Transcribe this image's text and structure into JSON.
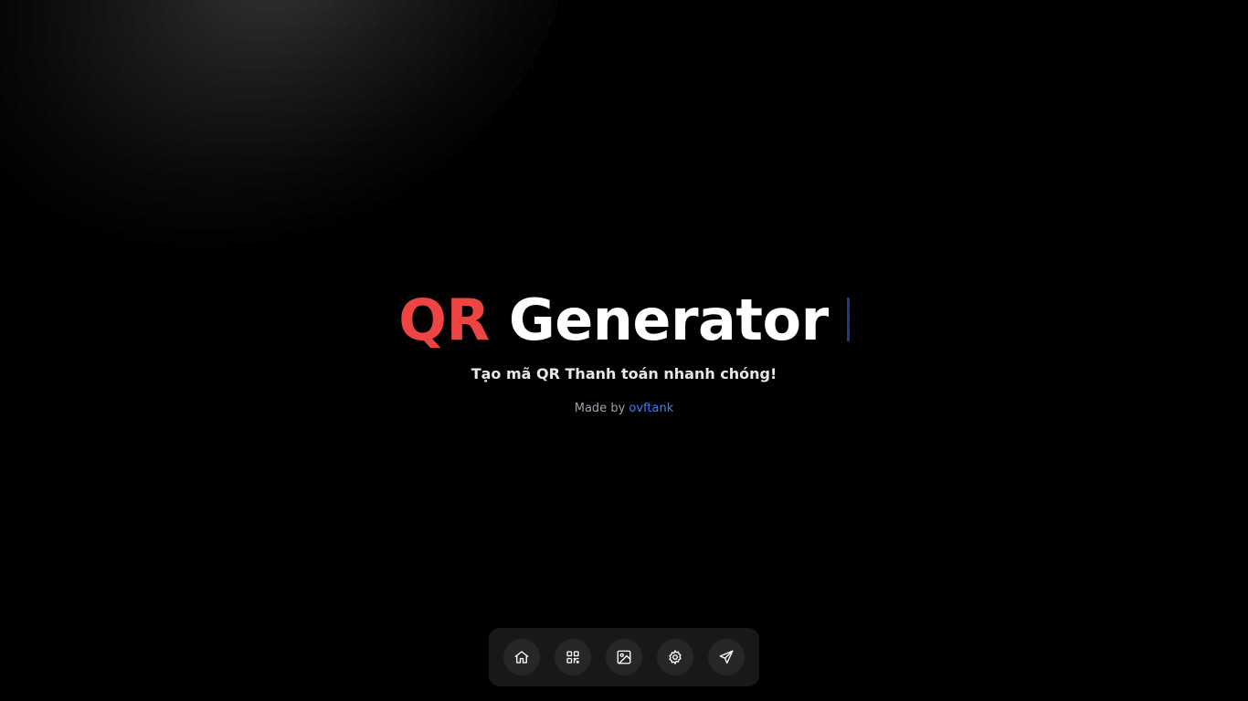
{
  "hero": {
    "title_accent": "QR",
    "title_main": "Generator",
    "subtitle": "Tạo mã QR Thanh toán nhanh chóng!",
    "credit_prefix": "Made by",
    "credit_author": "ovftank"
  },
  "dock": {
    "items": [
      {
        "icon": "home-icon"
      },
      {
        "icon": "qr-code-icon"
      },
      {
        "icon": "image-icon"
      },
      {
        "icon": "gear-icon"
      },
      {
        "icon": "send-icon"
      }
    ]
  },
  "colors": {
    "background": "#000000",
    "accent": "#ef4444",
    "title": "#ffffff",
    "link": "#3b82f6",
    "caret": "#1e3a8a",
    "dock": "#18181b",
    "dock_button": "#27272a"
  }
}
